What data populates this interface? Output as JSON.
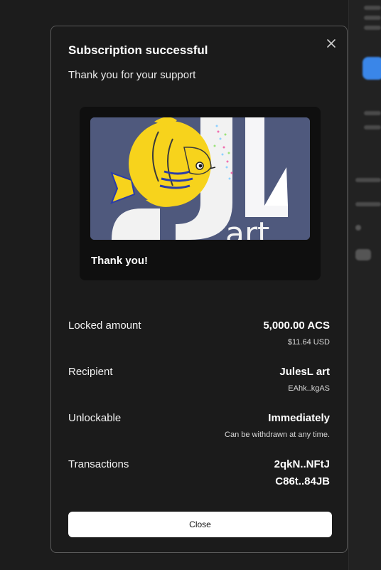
{
  "modal": {
    "title": "Subscription successful",
    "subtitle": "Thank you for your support",
    "close_icon": "close-icon",
    "card": {
      "image": "jules-l-art-fish-logo",
      "label": "Thank you!"
    },
    "rows": [
      {
        "label": "Locked amount",
        "value": "5,000.00 ACS",
        "sub": "$11.64 USD"
      },
      {
        "label": "Recipient",
        "value": "JulesL art",
        "sub": "EAhk..kgAS"
      },
      {
        "label": "Unlockable",
        "value": "Immediately",
        "sub": "Can be withdrawn at any time."
      },
      {
        "label": "Transactions",
        "value": "2qkN..NFtJ",
        "value2": "C86t..84JB"
      }
    ],
    "close_button": "Close"
  },
  "colors": {
    "background": "#1c1c1c",
    "modal_bg": "#1b1b1b",
    "modal_border": "#5a5a5a",
    "art_bg": "#4f597d",
    "fish_yellow": "#f7d31c",
    "button_bg": "#ffffff"
  }
}
